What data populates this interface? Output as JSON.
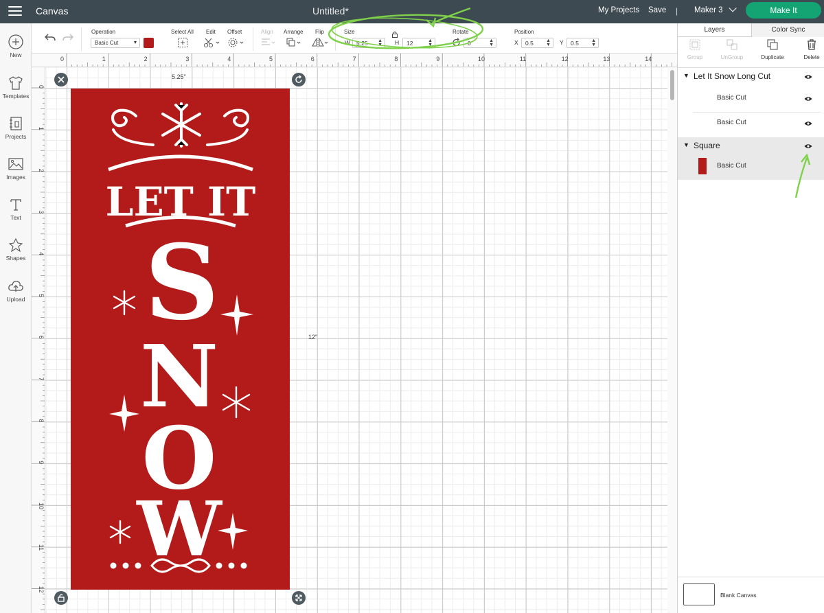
{
  "topbar": {
    "app_title": "Canvas",
    "doc_title": "Untitled*",
    "my_projects": "My Projects",
    "save": "Save",
    "separator": "|",
    "machine": "Maker 3",
    "make_it": "Make It"
  },
  "left_tools": [
    {
      "label": "New",
      "icon": "plus-circle-icon"
    },
    {
      "label": "Templates",
      "icon": "shirt-icon"
    },
    {
      "label": "Projects",
      "icon": "projects-icon"
    },
    {
      "label": "Images",
      "icon": "image-icon"
    },
    {
      "label": "Text",
      "icon": "text-icon"
    },
    {
      "label": "Shapes",
      "icon": "shapes-icon"
    },
    {
      "label": "Upload",
      "icon": "upload-icon"
    }
  ],
  "editbar": {
    "operation_label": "Operation",
    "operation_value": "Basic Cut",
    "operation_color": "#b31b1b",
    "select_all": "Select All",
    "edit": "Edit",
    "offset": "Offset",
    "align": "Align",
    "arrange": "Arrange",
    "flip": "Flip",
    "size_label": "Size",
    "w_label": "W",
    "w_value": "5.25",
    "h_label": "H",
    "h_value": "12",
    "rotate_label": "Rotate",
    "rotate_value": "0",
    "position_label": "Position",
    "x_label": "X",
    "x_value": "0.5",
    "y_label": "Y",
    "y_value": "0.5"
  },
  "ruler": {
    "top": [
      "0",
      "1",
      "2",
      "3",
      "4",
      "5",
      "6",
      "7",
      "8",
      "9",
      "10",
      "11",
      "12",
      "13",
      "14"
    ],
    "left": [
      "0",
      "1",
      "2",
      "3",
      "4",
      "5",
      "6",
      "7",
      "8",
      "9",
      "10",
      "11",
      "12"
    ]
  },
  "design": {
    "width_label": "5.25\"",
    "height_label": "12\"",
    "fill": "#b31b1b",
    "words": [
      "LET IT",
      "S",
      "N",
      "O",
      "W"
    ]
  },
  "layers_panel": {
    "tab_layers": "Layers",
    "tab_color_sync": "Color Sync",
    "group": "Group",
    "ungroup": "UnGroup",
    "duplicate": "Duplicate",
    "delete": "Delete",
    "groups": [
      {
        "name": "Let It Snow Long Cut",
        "layers": [
          {
            "label": "Basic Cut"
          },
          {
            "label": "Basic Cut"
          }
        ]
      },
      {
        "name": "Square",
        "layers": [
          {
            "label": "Basic Cut",
            "swatch": "#b31b1b"
          }
        ]
      }
    ],
    "blank_canvas": "Blank Canvas"
  },
  "annotation_color": "#7fd14a"
}
